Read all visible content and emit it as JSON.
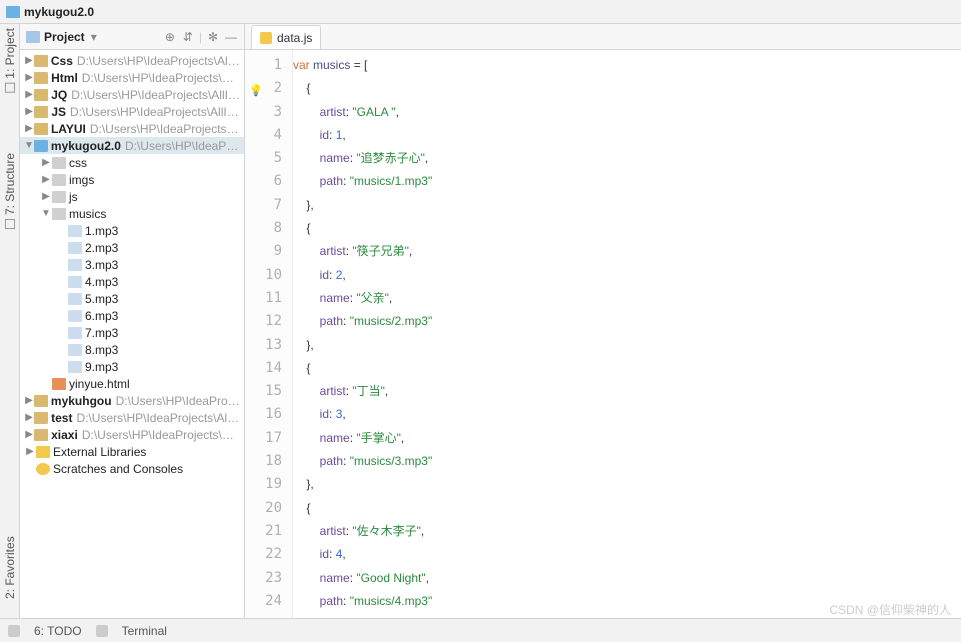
{
  "window": {
    "title": "mykugou2.0"
  },
  "project_panel": {
    "label": "Project",
    "icons": {
      "target": "⊕",
      "collapse": "⇵",
      "gear": "✻",
      "hide": "—"
    }
  },
  "tree": [
    {
      "depth": 0,
      "twist": "▶",
      "icon": "folder",
      "bold": true,
      "name": "Css",
      "path": "D:\\Users\\HP\\IdeaProjects\\AllIn_Web\\"
    },
    {
      "depth": 0,
      "twist": "▶",
      "icon": "folder",
      "bold": true,
      "name": "Html",
      "path": "D:\\Users\\HP\\IdeaProjects\\AllIn_We"
    },
    {
      "depth": 0,
      "twist": "▶",
      "icon": "folder",
      "bold": true,
      "name": "JQ",
      "path": "D:\\Users\\HP\\IdeaProjects\\AllIn_Web\\"
    },
    {
      "depth": 0,
      "twist": "▶",
      "icon": "folder",
      "bold": true,
      "name": "JS",
      "path": "D:\\Users\\HP\\IdeaProjects\\AllIn_Web\\"
    },
    {
      "depth": 0,
      "twist": "▶",
      "icon": "folder",
      "bold": true,
      "name": "LAYUI",
      "path": "D:\\Users\\HP\\IdeaProjects\\AllIn_W"
    },
    {
      "depth": 0,
      "twist": "▼",
      "icon": "folder-cyan",
      "bold": true,
      "sel": true,
      "name": "mykugou2.0",
      "path": "D:\\Users\\HP\\IdeaProjects\\"
    },
    {
      "depth": 1,
      "twist": "▶",
      "icon": "folder-dim",
      "name": "css"
    },
    {
      "depth": 1,
      "twist": "▶",
      "icon": "folder-dim",
      "name": "imgs"
    },
    {
      "depth": 1,
      "twist": "▶",
      "icon": "folder-dim",
      "name": "js"
    },
    {
      "depth": 1,
      "twist": "▼",
      "icon": "folder-dim",
      "name": "musics"
    },
    {
      "depth": 2,
      "twist": "",
      "icon": "mp3",
      "name": "1.mp3"
    },
    {
      "depth": 2,
      "twist": "",
      "icon": "mp3",
      "name": "2.mp3"
    },
    {
      "depth": 2,
      "twist": "",
      "icon": "mp3",
      "name": "3.mp3"
    },
    {
      "depth": 2,
      "twist": "",
      "icon": "mp3",
      "name": "4.mp3"
    },
    {
      "depth": 2,
      "twist": "",
      "icon": "mp3",
      "name": "5.mp3"
    },
    {
      "depth": 2,
      "twist": "",
      "icon": "mp3",
      "name": "6.mp3"
    },
    {
      "depth": 2,
      "twist": "",
      "icon": "mp3",
      "name": "7.mp3"
    },
    {
      "depth": 2,
      "twist": "",
      "icon": "mp3",
      "name": "8.mp3"
    },
    {
      "depth": 2,
      "twist": "",
      "icon": "mp3",
      "name": "9.mp3"
    },
    {
      "depth": 1,
      "twist": "",
      "icon": "html",
      "name": "yinyue.html"
    },
    {
      "depth": 0,
      "twist": "▶",
      "icon": "folder",
      "bold": true,
      "name": "mykuhgou",
      "path": "D:\\Users\\HP\\IdeaProjects\\Al"
    },
    {
      "depth": 0,
      "twist": "▶",
      "icon": "folder",
      "bold": true,
      "name": "test",
      "path": "D:\\Users\\HP\\IdeaProjects\\AllIn_Web"
    },
    {
      "depth": 0,
      "twist": "▶",
      "icon": "folder",
      "bold": true,
      "name": "xiaxi",
      "path": "D:\\Users\\HP\\IdeaProjects\\AllIn_We"
    },
    {
      "depth": 0,
      "twist": "▶",
      "icon": "lib",
      "name": "External Libraries"
    },
    {
      "depth": 0,
      "twist": "",
      "icon": "scratch",
      "name": "Scratches and Consoles"
    }
  ],
  "editor_tab": {
    "label": "data.js"
  },
  "code": {
    "lines": [
      {
        "n": 1,
        "seg": [
          {
            "c": "kw",
            "t": "var "
          },
          {
            "c": "ident",
            "t": "musics"
          },
          {
            "c": "punc",
            "t": " = ["
          }
        ]
      },
      {
        "n": 2,
        "bulb": true,
        "seg": [
          {
            "c": "punc",
            "t": "    {"
          }
        ]
      },
      {
        "n": 3,
        "seg": [
          {
            "c": "punc",
            "t": "        "
          },
          {
            "c": "prop",
            "t": "artist"
          },
          {
            "c": "punc",
            "t": ": "
          },
          {
            "c": "str",
            "t": "\"GALA \""
          },
          {
            "c": "punc",
            "t": ","
          }
        ]
      },
      {
        "n": 4,
        "seg": [
          {
            "c": "punc",
            "t": "        "
          },
          {
            "c": "prop",
            "t": "id"
          },
          {
            "c": "punc",
            "t": ": "
          },
          {
            "c": "num",
            "t": "1"
          },
          {
            "c": "punc",
            "t": ","
          }
        ]
      },
      {
        "n": 5,
        "seg": [
          {
            "c": "punc",
            "t": "        "
          },
          {
            "c": "prop",
            "t": "name"
          },
          {
            "c": "punc",
            "t": ": "
          },
          {
            "c": "str",
            "t": "\"追梦赤子心\""
          },
          {
            "c": "punc",
            "t": ","
          }
        ]
      },
      {
        "n": 6,
        "seg": [
          {
            "c": "punc",
            "t": "        "
          },
          {
            "c": "prop",
            "t": "path"
          },
          {
            "c": "punc",
            "t": ": "
          },
          {
            "c": "str",
            "t": "\"musics/1.mp3\""
          }
        ]
      },
      {
        "n": 7,
        "seg": [
          {
            "c": "punc",
            "t": "    },"
          }
        ]
      },
      {
        "n": 8,
        "seg": [
          {
            "c": "punc",
            "t": "    {"
          }
        ]
      },
      {
        "n": 9,
        "seg": [
          {
            "c": "punc",
            "t": "        "
          },
          {
            "c": "prop",
            "t": "artist"
          },
          {
            "c": "punc",
            "t": ": "
          },
          {
            "c": "str",
            "t": "\"筷子兄弟\""
          },
          {
            "c": "punc",
            "t": ","
          }
        ]
      },
      {
        "n": 10,
        "seg": [
          {
            "c": "punc",
            "t": "        "
          },
          {
            "c": "prop",
            "t": "id"
          },
          {
            "c": "punc",
            "t": ": "
          },
          {
            "c": "num",
            "t": "2"
          },
          {
            "c": "punc",
            "t": ","
          }
        ]
      },
      {
        "n": 11,
        "seg": [
          {
            "c": "punc",
            "t": "        "
          },
          {
            "c": "prop",
            "t": "name"
          },
          {
            "c": "punc",
            "t": ": "
          },
          {
            "c": "str",
            "t": "\"父亲\""
          },
          {
            "c": "punc",
            "t": ","
          }
        ]
      },
      {
        "n": 12,
        "seg": [
          {
            "c": "punc",
            "t": "        "
          },
          {
            "c": "prop",
            "t": "path"
          },
          {
            "c": "punc",
            "t": ": "
          },
          {
            "c": "str",
            "t": "\"musics/2.mp3\""
          }
        ]
      },
      {
        "n": 13,
        "seg": [
          {
            "c": "punc",
            "t": "    },"
          }
        ]
      },
      {
        "n": 14,
        "seg": [
          {
            "c": "punc",
            "t": "    {"
          }
        ]
      },
      {
        "n": 15,
        "seg": [
          {
            "c": "punc",
            "t": "        "
          },
          {
            "c": "prop",
            "t": "artist"
          },
          {
            "c": "punc",
            "t": ": "
          },
          {
            "c": "str",
            "t": "\"丁当\""
          },
          {
            "c": "punc",
            "t": ","
          }
        ]
      },
      {
        "n": 16,
        "seg": [
          {
            "c": "punc",
            "t": "        "
          },
          {
            "c": "prop",
            "t": "id"
          },
          {
            "c": "punc",
            "t": ": "
          },
          {
            "c": "num",
            "t": "3"
          },
          {
            "c": "punc",
            "t": ","
          }
        ]
      },
      {
        "n": 17,
        "seg": [
          {
            "c": "punc",
            "t": "        "
          },
          {
            "c": "prop",
            "t": "name"
          },
          {
            "c": "punc",
            "t": ": "
          },
          {
            "c": "str",
            "t": "\"手掌心\""
          },
          {
            "c": "punc",
            "t": ","
          }
        ]
      },
      {
        "n": 18,
        "seg": [
          {
            "c": "punc",
            "t": "        "
          },
          {
            "c": "prop",
            "t": "path"
          },
          {
            "c": "punc",
            "t": ": "
          },
          {
            "c": "str",
            "t": "\"musics/3.mp3\""
          }
        ]
      },
      {
        "n": 19,
        "seg": [
          {
            "c": "punc",
            "t": "    },"
          }
        ]
      },
      {
        "n": 20,
        "seg": [
          {
            "c": "punc",
            "t": "    {"
          }
        ]
      },
      {
        "n": 21,
        "seg": [
          {
            "c": "punc",
            "t": "        "
          },
          {
            "c": "prop",
            "t": "artist"
          },
          {
            "c": "punc",
            "t": ": "
          },
          {
            "c": "str",
            "t": "\"佐々木李子\""
          },
          {
            "c": "punc",
            "t": ","
          }
        ]
      },
      {
        "n": 22,
        "seg": [
          {
            "c": "punc",
            "t": "        "
          },
          {
            "c": "prop",
            "t": "id"
          },
          {
            "c": "punc",
            "t": ": "
          },
          {
            "c": "num",
            "t": "4"
          },
          {
            "c": "punc",
            "t": ","
          }
        ]
      },
      {
        "n": 23,
        "seg": [
          {
            "c": "punc",
            "t": "        "
          },
          {
            "c": "prop",
            "t": "name"
          },
          {
            "c": "punc",
            "t": ": "
          },
          {
            "c": "str",
            "t": "\"Good Night\""
          },
          {
            "c": "punc",
            "t": ","
          }
        ]
      },
      {
        "n": 24,
        "seg": [
          {
            "c": "punc",
            "t": "        "
          },
          {
            "c": "prop",
            "t": "path"
          },
          {
            "c": "punc",
            "t": ": "
          },
          {
            "c": "str",
            "t": "\"musics/4.mp3\""
          }
        ]
      }
    ]
  },
  "side_tabs": {
    "project": "1: Project",
    "structure": "7: Structure",
    "favorites": "2: Favorites"
  },
  "status": {
    "todo": "6: TODO",
    "terminal": "Terminal"
  },
  "watermark": "CSDN @信仰柴神的人"
}
